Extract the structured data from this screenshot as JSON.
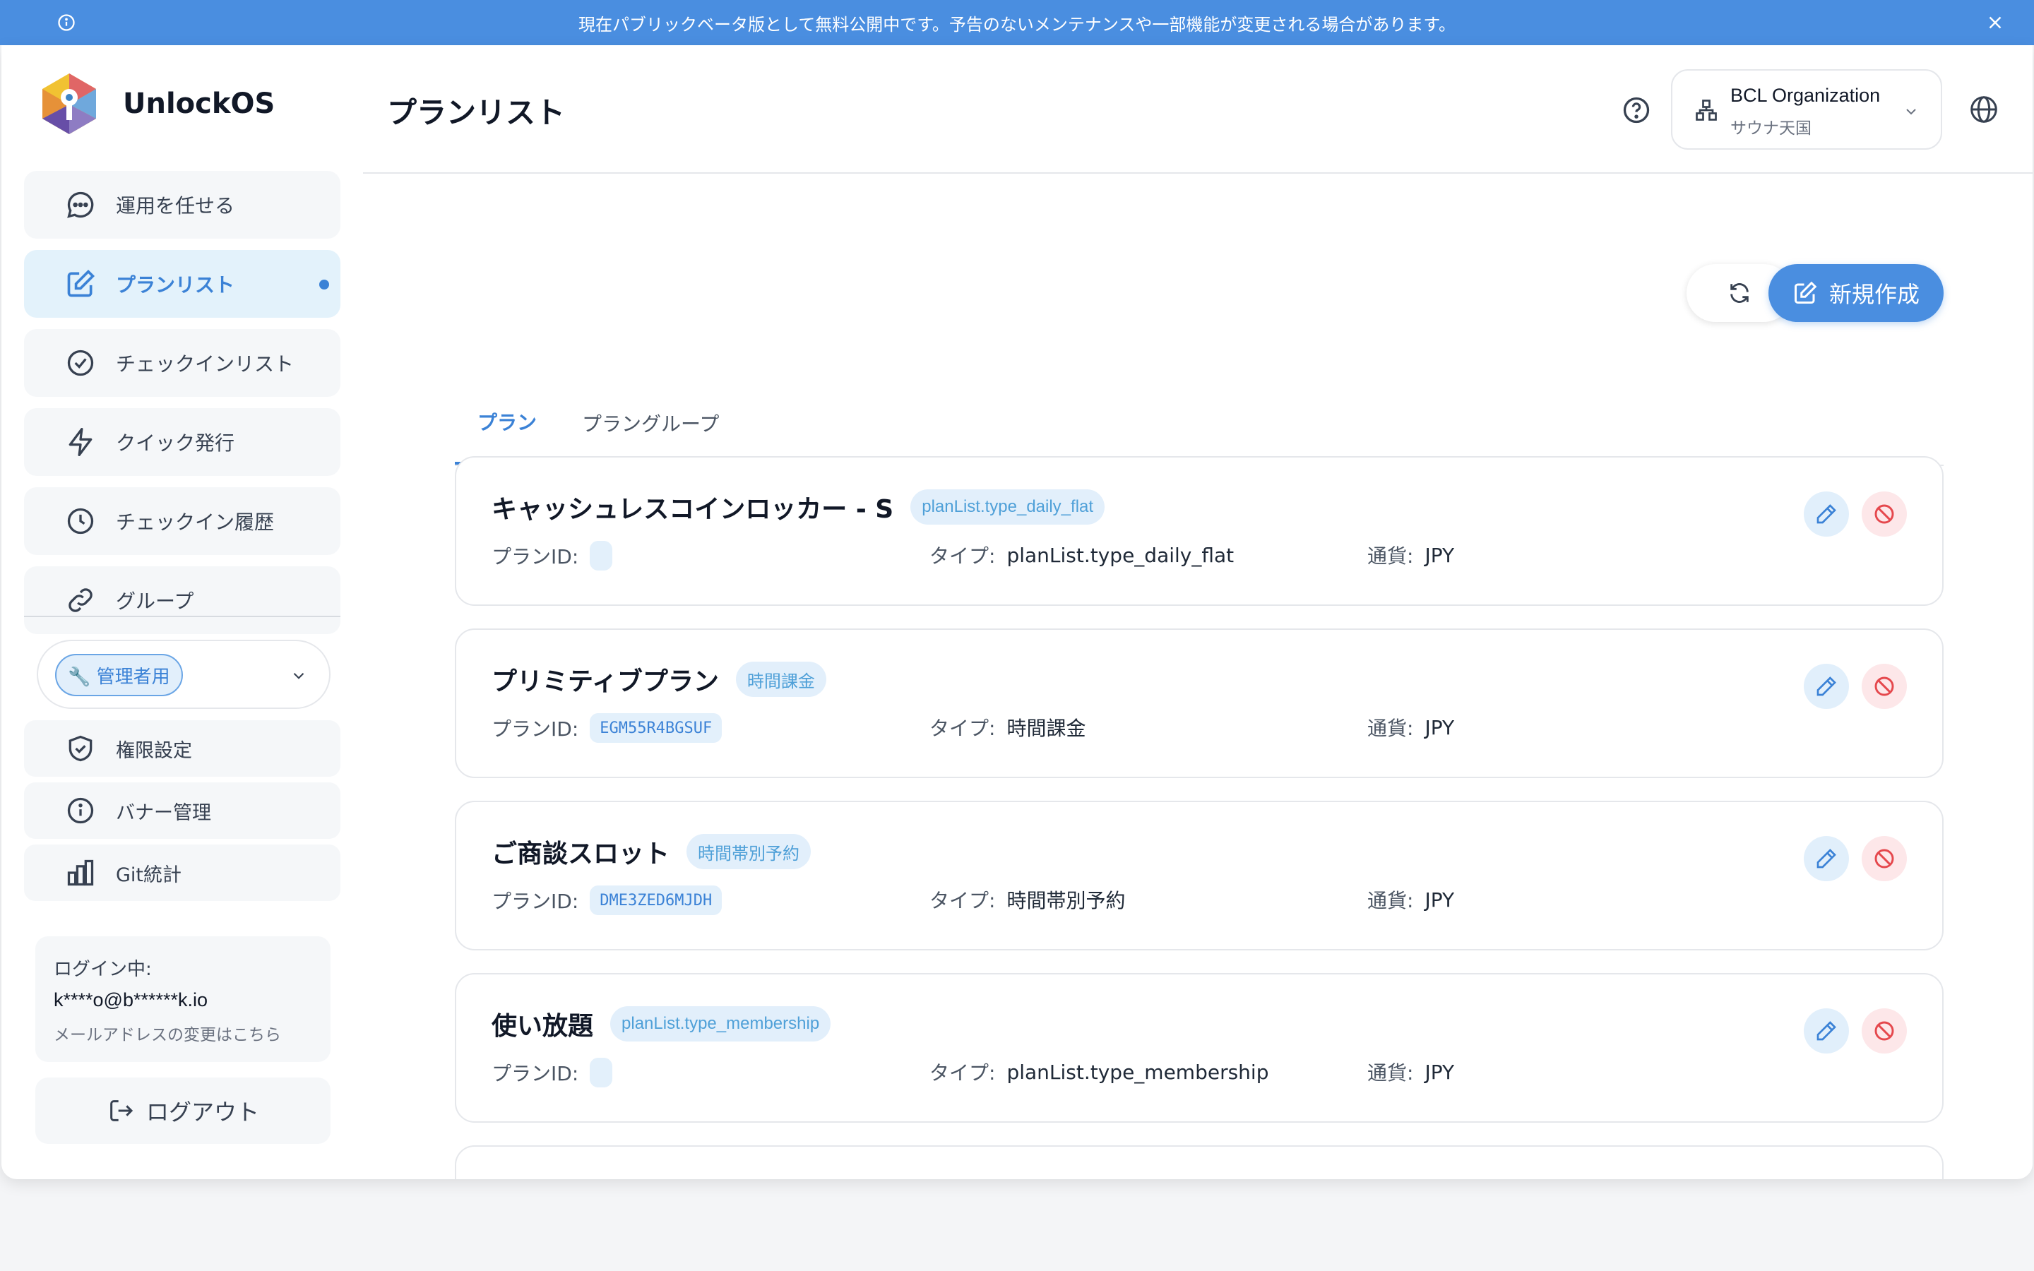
{
  "banner": {
    "text": "現在パブリックベータ版として無料公開中です。予告のないメンテナンスや一部機能が変更される場合があります。"
  },
  "brand": {
    "name": "UnlockOS"
  },
  "nav": {
    "items": [
      {
        "label": "運用を任せる",
        "icon": "chat-bubble-icon"
      },
      {
        "label": "プランリスト",
        "icon": "edit-icon",
        "active": true
      },
      {
        "label": "チェックインリスト",
        "icon": "check-circle-icon"
      },
      {
        "label": "クイック発行",
        "icon": "bolt-icon"
      },
      {
        "label": "チェックイン履歴",
        "icon": "clock-icon"
      },
      {
        "label": "グループ",
        "icon": "link-icon"
      }
    ]
  },
  "role": {
    "selected": "🔧 管理者用"
  },
  "admin": {
    "items": [
      {
        "label": "権限設定",
        "icon": "shield-check-icon"
      },
      {
        "label": "バナー管理",
        "icon": "info-icon"
      },
      {
        "label": "Git統計",
        "icon": "bar-chart-icon"
      }
    ]
  },
  "login": {
    "label": "ログイン中:",
    "email": "k****o@b******k.io",
    "change_link": "メールアドレスの変更はこちら"
  },
  "logout": {
    "label": "ログアウト"
  },
  "header": {
    "title": "プランリスト",
    "org_name": "BCL Organization",
    "org_sub": "サウナ天国"
  },
  "actions": {
    "new_label": "新規作成"
  },
  "tabs": [
    {
      "label": "プラン",
      "active": true
    },
    {
      "label": "プラングループ"
    }
  ],
  "plans": [
    {
      "name": "キャッシュレスコインロッカー - S",
      "badge": "planList.type_daily_flat",
      "id_label": "プランID:",
      "id": "",
      "type_label": "タイプ:",
      "type": "planList.type_daily_flat",
      "currency_label": "通貨:",
      "currency": "JPY"
    },
    {
      "name": "プリミティブプラン",
      "badge": "時間課金",
      "id_label": "プランID:",
      "id": "EGM55R4BGSUF",
      "type_label": "タイプ:",
      "type": "時間課金",
      "currency_label": "通貨:",
      "currency": "JPY"
    },
    {
      "name": "ご商談スロット",
      "badge": "時間帯別予約",
      "id_label": "プランID:",
      "id": "DME3ZED6MJDH",
      "type_label": "タイプ:",
      "type": "時間帯別予約",
      "currency_label": "通貨:",
      "currency": "JPY"
    },
    {
      "name": "使い放題",
      "badge": "planList.type_membership",
      "id_label": "プランID:",
      "id": "",
      "type_label": "タイプ:",
      "type": "planList.type_membership",
      "currency_label": "通貨:",
      "currency": "JPY"
    }
  ],
  "colors": {
    "accent": "#4a8ee0",
    "accent_text": "#3b82d6",
    "danger": "#e5484d",
    "badge_bg": "#e2effb"
  }
}
